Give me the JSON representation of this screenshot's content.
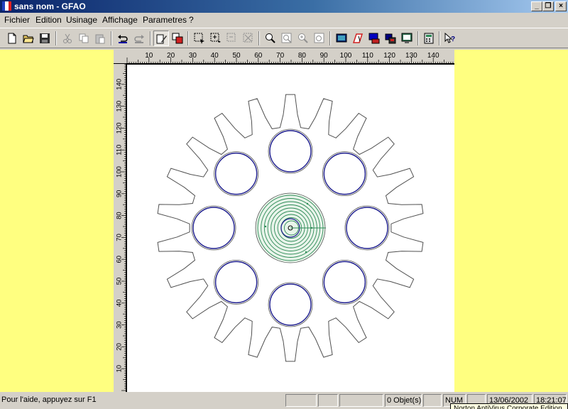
{
  "window": {
    "title": "sans nom - GFAO"
  },
  "menu": {
    "items": [
      {
        "label": "Fichier"
      },
      {
        "label": "Edition"
      },
      {
        "label": "Usinage"
      },
      {
        "label": "Affichage"
      },
      {
        "label": "Parametres"
      },
      {
        "label": "?"
      }
    ]
  },
  "toolbar": {
    "buttons": [
      {
        "icon": "new-file-icon"
      },
      {
        "icon": "open-folder-icon"
      },
      {
        "icon": "save-icon"
      },
      {
        "icon": "cut-icon"
      },
      {
        "icon": "copy-icon"
      },
      {
        "icon": "paste-icon"
      },
      {
        "icon": "undo-icon"
      },
      {
        "icon": "redo-icon"
      },
      {
        "icon": "draw-pen-icon"
      },
      {
        "icon": "layers-icon"
      },
      {
        "icon": "select-icon"
      },
      {
        "icon": "select-plus-icon"
      },
      {
        "icon": "select-minus-icon"
      },
      {
        "icon": "delete-selection-icon"
      },
      {
        "icon": "zoom-icon"
      },
      {
        "icon": "zoom-window-icon"
      },
      {
        "icon": "zoom-in-icon"
      },
      {
        "icon": "zoom-all-icon"
      },
      {
        "icon": "display-icon"
      },
      {
        "icon": "tool-path-icon"
      },
      {
        "icon": "machine-icon"
      },
      {
        "icon": "transfer-icon"
      },
      {
        "icon": "monitor-icon"
      },
      {
        "icon": "calculator-icon"
      },
      {
        "icon": "help-pointer-icon"
      }
    ]
  },
  "rulers": {
    "horizontal": [
      "10",
      "20",
      "30",
      "40",
      "50",
      "60",
      "70",
      "80",
      "90",
      "100",
      "110",
      "120",
      "130",
      "140"
    ],
    "vertical": [
      "140",
      "130",
      "120",
      "110",
      "100",
      "90",
      "80",
      "70",
      "60",
      "50",
      "40",
      "30",
      "20",
      "10"
    ]
  },
  "drawing": {
    "colors": {
      "outline": "#505050",
      "holes": "#1a1a8c",
      "spiral": "#2e8b57",
      "background": "#ffffff",
      "workspace": "#ffff80"
    }
  },
  "status": {
    "help": "Pour l'aide, appuyez sur F1",
    "objects": "0 Objet(s)",
    "num": "NUM",
    "date": "13/06/2002",
    "time": "18:21:07"
  },
  "tooltip": {
    "text": "Norton AntiVirus Corporate Edition"
  }
}
